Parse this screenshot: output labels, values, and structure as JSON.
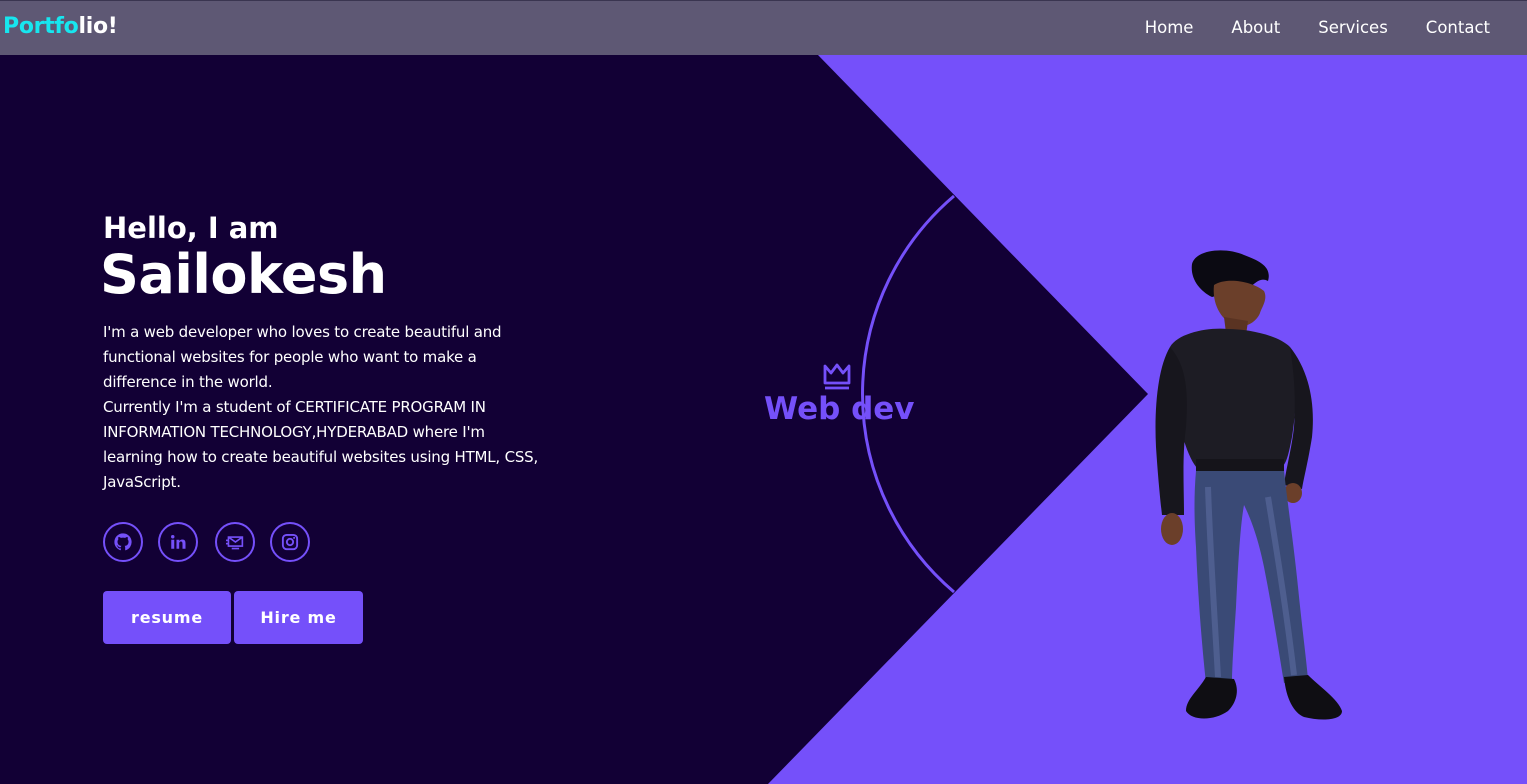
{
  "colors": {
    "background": "#120035",
    "accent": "#7550fa",
    "navbar": "#5e5874",
    "logo_accent": "#17e6ef",
    "text": "#ffffff"
  },
  "nav": {
    "logo_part1": "Portfo",
    "logo_part2": "lio!",
    "links": [
      "Home",
      "About",
      "Services",
      "Contact"
    ]
  },
  "hero": {
    "greeting": "Hello, I am",
    "name": "Sailokesh",
    "bio_lines": [
      "I'm a web developer who loves to create beautiful and functional websites for people who want to make a difference in the world.",
      "Currently I'm a student of CERTIFICATE PROGRAM IN INFORMATION TECHNOLOGY,HYDERABAD where I'm learning how to create beautiful websites using HTML, CSS, JavaScript."
    ],
    "socials": [
      "github-icon",
      "linkedin-icon",
      "mail-icon",
      "instagram-icon"
    ],
    "buttons": {
      "resume": "resume",
      "hire": "Hire me"
    }
  },
  "badge": {
    "icon": "crown-icon",
    "label": "Web dev"
  }
}
